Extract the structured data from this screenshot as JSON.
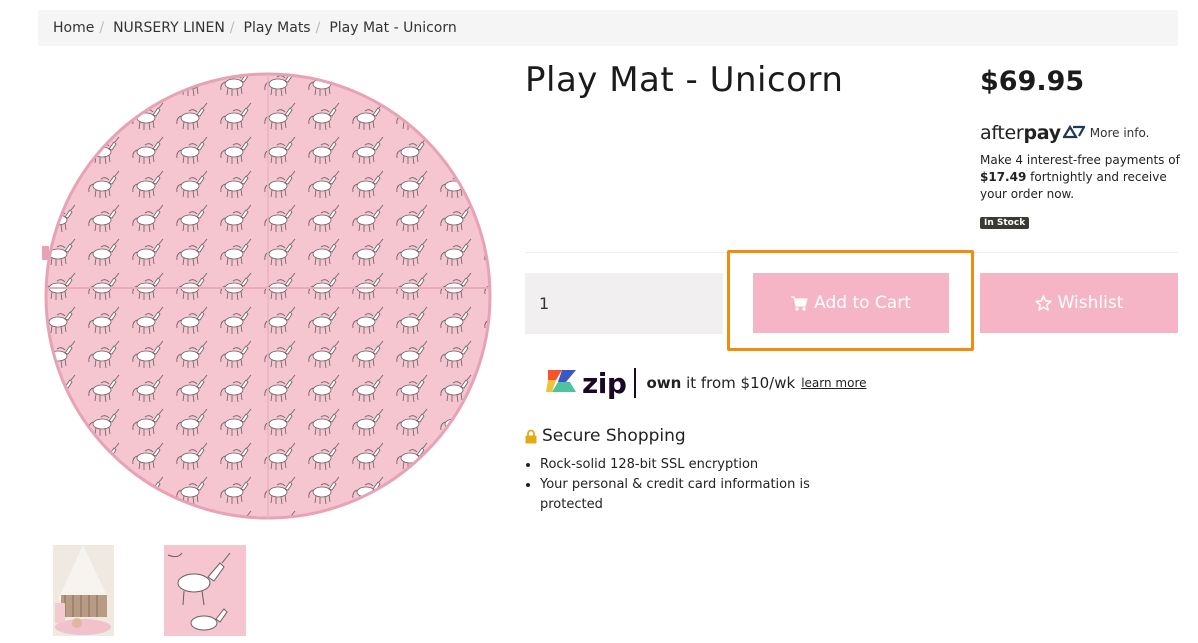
{
  "breadcrumb": {
    "items": [
      "Home",
      "NURSERY LINEN",
      "Play Mats",
      "Play Mat - Unicorn"
    ]
  },
  "product": {
    "title": "Play Mat - Unicorn",
    "price": "$69.95",
    "stock": "In Stock"
  },
  "afterpay": {
    "logo_light": "after",
    "logo_bold": "pay",
    "more_info": "More info.",
    "text_before": "Make 4 interest-free payments of",
    "amount": "$17.49",
    "text_after": "fortnightly and receive your order now."
  },
  "cart": {
    "quantity": "1",
    "add_label": "Add to Cart",
    "wishlist_label": "Wishlist"
  },
  "zip": {
    "logo": "zip",
    "own": "own",
    "text": "it from $10/wk",
    "learn_more": "learn more"
  },
  "secure": {
    "heading": "Secure Shopping",
    "items": [
      "Rock-solid 128-bit SSL encryption",
      "Your personal & credit card information is protected"
    ]
  },
  "colors": {
    "button_pink": "#f6b5c6",
    "highlight_orange": "#f28c0f",
    "mat_pink": "#f5c6d0"
  },
  "icons": [
    "cart-icon",
    "star-icon",
    "lock-icon",
    "afterpay-arrows-icon",
    "zip-logo-icon"
  ]
}
